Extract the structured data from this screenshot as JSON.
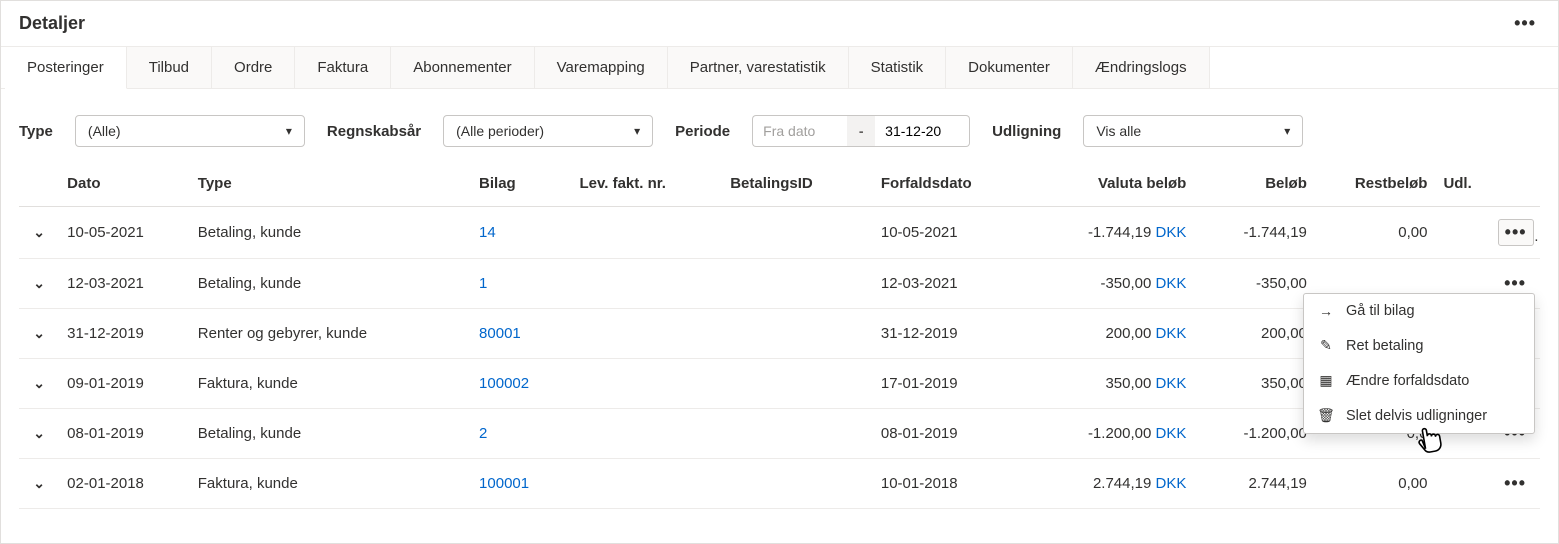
{
  "panel": {
    "title": "Detaljer"
  },
  "tabs": {
    "active_index": 0,
    "items": [
      {
        "label": "Posteringer"
      },
      {
        "label": "Tilbud"
      },
      {
        "label": "Ordre"
      },
      {
        "label": "Faktura"
      },
      {
        "label": "Abonnementer"
      },
      {
        "label": "Varemapping"
      },
      {
        "label": "Partner, varestatistik"
      },
      {
        "label": "Statistik"
      },
      {
        "label": "Dokumenter"
      },
      {
        "label": "Ændringslogs"
      }
    ]
  },
  "filters": {
    "type_label": "Type",
    "type_value": "(Alle)",
    "year_label": "Regnskabsår",
    "year_value": "(Alle perioder)",
    "periode_label": "Periode",
    "date_from_placeholder": "Fra dato",
    "date_sep": "-",
    "date_to_value": "31-12-20",
    "udligning_label": "Udligning",
    "udligning_value": "Vis alle"
  },
  "columns": {
    "dato": "Dato",
    "type": "Type",
    "bilag": "Bilag",
    "lev": "Lev. fakt. nr.",
    "bet": "BetalingsID",
    "forf": "Forfaldsdato",
    "val": "Valuta beløb",
    "bel": "Beløb",
    "rest": "Restbeløb",
    "udl": "Udl."
  },
  "currency": "DKK",
  "rows": [
    {
      "dato": "10-05-2021",
      "type": "Betaling, kunde",
      "bilag": "14",
      "lev": "",
      "bet": "",
      "forf": "10-05-2021",
      "val": "-1.744,19",
      "bel": "-1.744,19",
      "rest": "0,00",
      "udl": "",
      "menu_open": true
    },
    {
      "dato": "12-03-2021",
      "type": "Betaling, kunde",
      "bilag": "1",
      "lev": "",
      "bet": "",
      "forf": "12-03-2021",
      "val": "-350,00",
      "bel": "-350,00",
      "rest": "",
      "udl": ""
    },
    {
      "dato": "31-12-2019",
      "type": "Renter og gebyrer, kunde",
      "bilag": "80001",
      "lev": "",
      "bet": "",
      "forf": "31-12-2019",
      "val": "200,00",
      "bel": "200,00",
      "rest": "",
      "udl": ""
    },
    {
      "dato": "09-01-2019",
      "type": "Faktura, kunde",
      "bilag": "100002",
      "lev": "",
      "bet": "",
      "forf": "17-01-2019",
      "val": "350,00",
      "bel": "350,00",
      "rest": "",
      "udl": ""
    },
    {
      "dato": "08-01-2019",
      "type": "Betaling, kunde",
      "bilag": "2",
      "lev": "",
      "bet": "",
      "forf": "08-01-2019",
      "val": "-1.200,00",
      "bel": "-1.200,00",
      "rest": "0,0",
      "udl": ""
    },
    {
      "dato": "02-01-2018",
      "type": "Faktura, kunde",
      "bilag": "100001",
      "lev": "",
      "bet": "",
      "forf": "10-01-2018",
      "val": "2.744,19",
      "bel": "2.744,19",
      "rest": "0,00",
      "udl": ""
    }
  ],
  "context_menu": {
    "items": [
      {
        "icon": "arrow",
        "label": "Gå til bilag"
      },
      {
        "icon": "edit",
        "label": "Ret betaling"
      },
      {
        "icon": "calendar",
        "label": "Ændre forfaldsdato"
      },
      {
        "icon": "trash",
        "label": "Slet delvis udligninger"
      }
    ]
  }
}
